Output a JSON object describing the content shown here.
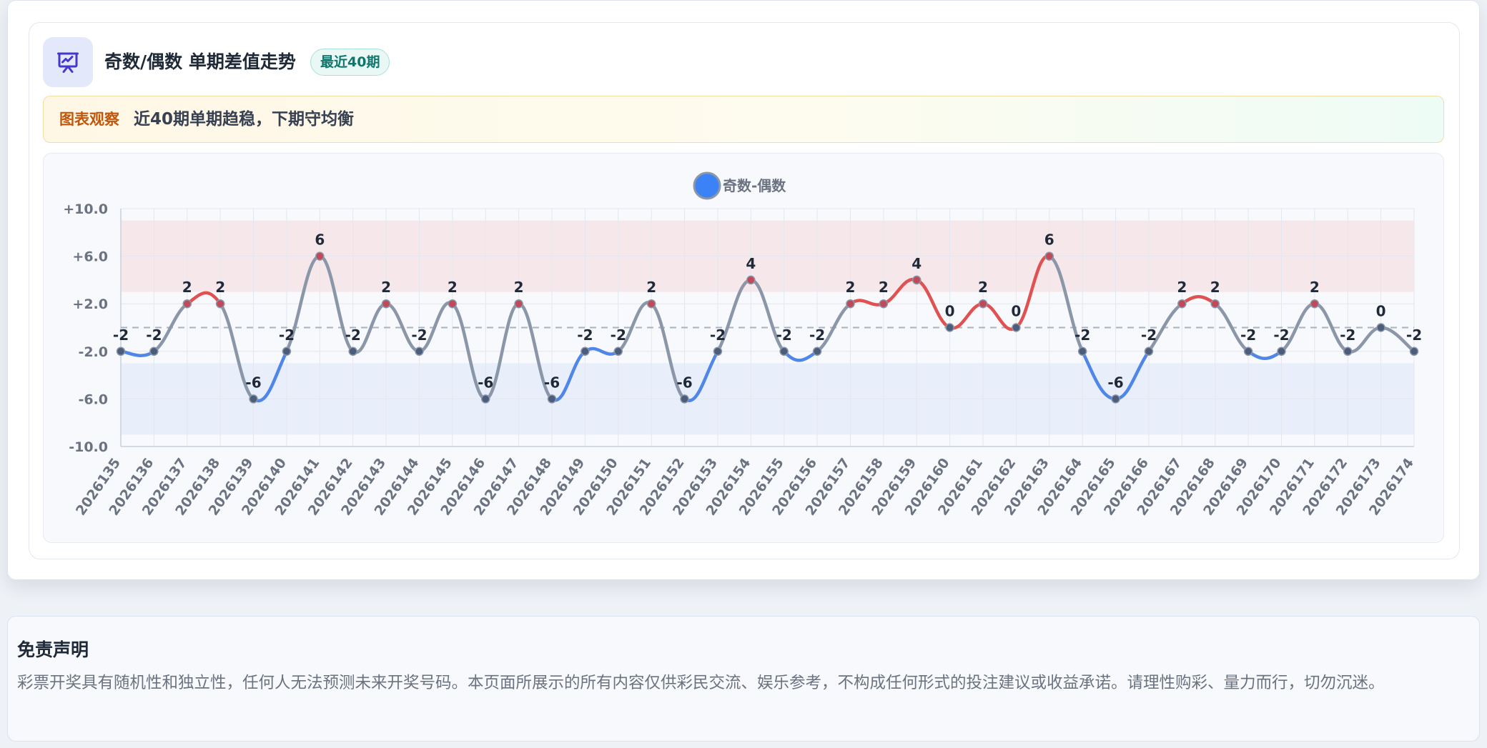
{
  "header": {
    "icon": "presentation-chart-icon",
    "title": "奇数/偶数 单期差值走势",
    "badge": "最近40期"
  },
  "observation": {
    "tag": "图表观察",
    "text": "近40期单期趋稳，下期守均衡"
  },
  "colors": {
    "positive": "#e05252",
    "negative": "#4f86e8",
    "neutral": "#8b97a8",
    "marker": "#6b7280",
    "positive_band": "#f6e8ea",
    "negative_band": "#e8eefa",
    "legend_dot": "#3b82f6"
  },
  "chart_data": {
    "type": "line",
    "title": "",
    "xlabel": "",
    "ylabel": "",
    "legend": [
      "奇数-偶数"
    ],
    "legend_position": "top-center",
    "grid": true,
    "ylim": [
      -10,
      10
    ],
    "yticks": [
      10,
      6,
      2,
      -2,
      -6,
      -10
    ],
    "ytick_labels": [
      "+10.0",
      "+6.0",
      "+2.0",
      "-2.0",
      "-6.0",
      "-10.0"
    ],
    "reference_line": 0,
    "bands": [
      {
        "from": 3,
        "to": 9,
        "tone": "positive"
      },
      {
        "from": -9,
        "to": -3,
        "tone": "negative"
      }
    ],
    "x": [
      "2026135",
      "2026136",
      "2026137",
      "2026138",
      "2026139",
      "2026140",
      "2026141",
      "2026142",
      "2026143",
      "2026144",
      "2026145",
      "2026146",
      "2026147",
      "2026148",
      "2026149",
      "2026150",
      "2026151",
      "2026152",
      "2026153",
      "2026154",
      "2026155",
      "2026156",
      "2026157",
      "2026158",
      "2026159",
      "2026160",
      "2026161",
      "2026162",
      "2026163",
      "2026164",
      "2026165",
      "2026166",
      "2026167",
      "2026168",
      "2026169",
      "2026170",
      "2026171",
      "2026172",
      "2026173",
      "2026174"
    ],
    "series": [
      {
        "name": "奇数-偶数",
        "values": [
          -2,
          -2,
          2,
          2,
          -6,
          -2,
          6,
          -2,
          2,
          -2,
          2,
          -6,
          2,
          -6,
          -2,
          -2,
          2,
          -6,
          -2,
          4,
          -2,
          -2,
          2,
          2,
          4,
          0,
          2,
          0,
          6,
          -2,
          -6,
          -2,
          2,
          2,
          -2,
          -2,
          2,
          -2,
          0,
          -2
        ]
      }
    ]
  },
  "disclaimer": {
    "title": "免责声明",
    "text": "彩票开奖具有随机性和独立性，任何人无法预测未来开奖号码。本页面所展示的所有内容仅供彩民交流、娱乐参考，不构成任何形式的投注建议或收益承诺。请理性购彩、量力而行，切勿沉迷。"
  }
}
